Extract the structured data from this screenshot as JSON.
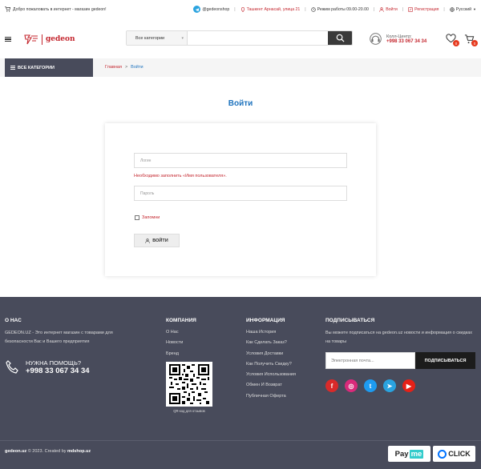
{
  "topbar": {
    "welcome": "Добро пожаловать в интернет - магазин gedeon!",
    "telegram": "@gedeonshop",
    "address": "Ташкент Арнасай, улица 21",
    "hours": "Режим работы 09.00-20.00",
    "login": "Войти",
    "register": "Регистрация",
    "language": "Русский"
  },
  "header": {
    "logo_text": "gedeon",
    "search": {
      "category": "Все категории",
      "placeholder": ""
    },
    "callcenter": {
      "label": "Колл-Центр:",
      "phone": "+998 33 067 34 34"
    },
    "wishlist_count": "0",
    "cart_count": "0"
  },
  "nav": {
    "all_categories": "ВСЕ КАТЕГОРИИ",
    "breadcrumb": [
      "Главная",
      ">",
      "Войти"
    ]
  },
  "login": {
    "title": "Войти",
    "username_placeholder": "Логин",
    "error": "Необходимо заполнить «Имя пользователя».",
    "password_placeholder": "Пароль",
    "remember": "Запомни",
    "button": "ВОЙТИ"
  },
  "footer": {
    "about": {
      "heading": "О НАС",
      "text": "GEDEON.UZ - Это интернет магазин с товарами для безопасности Вас и Вашего предприятия",
      "help_label": "НУЖНА ПОМОЩЬ?",
      "help_phone": "+998 33 067 34 34"
    },
    "company": {
      "heading": "КОМПАНИЯ",
      "links": [
        "О Нас",
        "Новости",
        "Бренд"
      ],
      "qr_caption": "QR-код для отзывов"
    },
    "info": {
      "heading": "ИНФОРМАЦИЯ",
      "links": [
        "Наша История",
        "Как Сделать Заказ?",
        "Условия Доставки",
        "Как Получить Скидку?",
        "Условия Использования",
        "Обмен И Возврат",
        "Публичная Оферта"
      ]
    },
    "subscribe": {
      "heading": "ПОДПИСЫВАТЬСЯ",
      "text": "Вы можете подписаться на gedeon.uz новости и информация о скидках на товары",
      "placeholder": "Электронная почта...",
      "button": "ПОДПИСЫВАТЬСЯ"
    },
    "socials": [
      {
        "name": "facebook",
        "color": "#d92a2a",
        "glyph": "f"
      },
      {
        "name": "instagram",
        "color": "#d92a7a",
        "glyph": "◎"
      },
      {
        "name": "twitter",
        "color": "#1d9bf0",
        "glyph": "t"
      },
      {
        "name": "telegram",
        "color": "#2aa3df",
        "glyph": "➤"
      },
      {
        "name": "youtube",
        "color": "#e62117",
        "glyph": "▶"
      }
    ],
    "copyright_site": "gedeon.uz",
    "copyright_mid": " © 2023. Created by ",
    "copyright_by": "mdshop.uz",
    "payments": {
      "payme_a": "Pay",
      "payme_b": "me",
      "click": "CLICK"
    }
  },
  "colors": {
    "brand_red": "#c4262e",
    "link_blue": "#1e73be",
    "footer_bg": "#484b5b"
  }
}
